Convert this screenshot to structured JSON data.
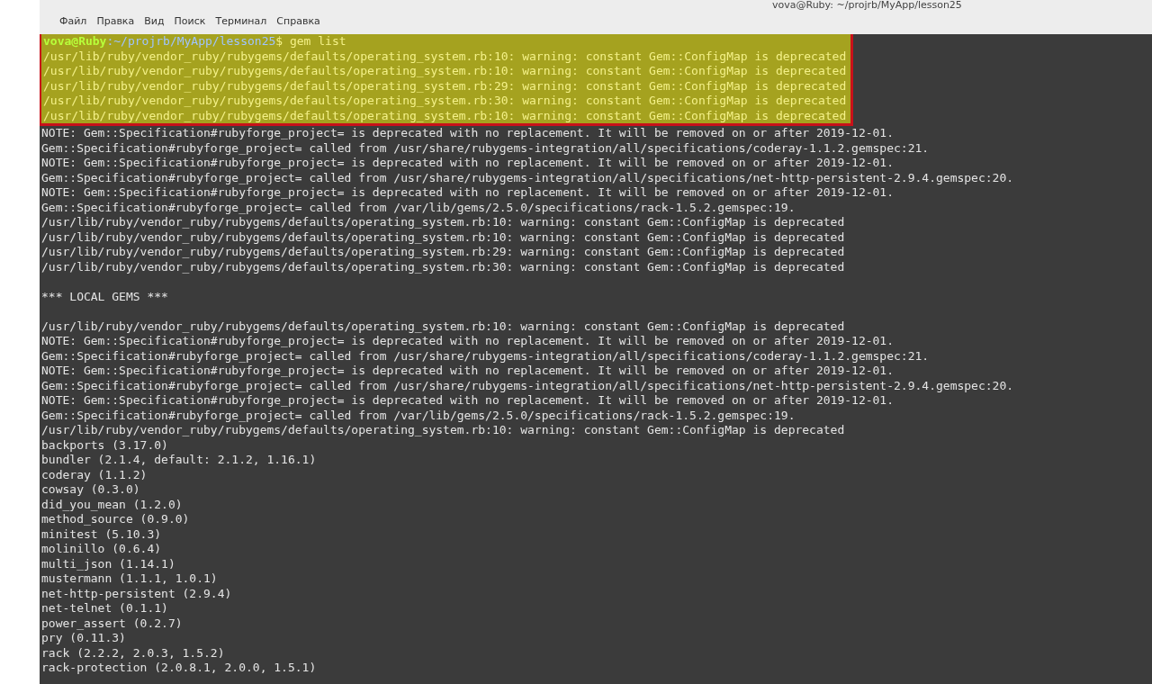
{
  "window": {
    "title": "vova@Ruby: ~/projrb/MyApp/lesson25"
  },
  "menu": [
    {
      "label": "Файл"
    },
    {
      "label": "Правка"
    },
    {
      "label": "Вид"
    },
    {
      "label": "Поиск"
    },
    {
      "label": "Терминал"
    },
    {
      "label": "Справка"
    }
  ],
  "terminal": {
    "lines": [
      {
        "kind": "prompt",
        "user": "vova@Ruby",
        "path": ":~/projrb/MyApp/lesson25",
        "command": "$ gem list",
        "highlighted": true
      },
      {
        "kind": "output",
        "text": "/usr/lib/ruby/vendor_ruby/rubygems/defaults/operating_system.rb:10: warning: constant Gem::ConfigMap is deprecated",
        "highlighted": true
      },
      {
        "kind": "output",
        "text": "/usr/lib/ruby/vendor_ruby/rubygems/defaults/operating_system.rb:10: warning: constant Gem::ConfigMap is deprecated",
        "highlighted": true
      },
      {
        "kind": "output",
        "text": "/usr/lib/ruby/vendor_ruby/rubygems/defaults/operating_system.rb:29: warning: constant Gem::ConfigMap is deprecated",
        "highlighted": true
      },
      {
        "kind": "output",
        "text": "/usr/lib/ruby/vendor_ruby/rubygems/defaults/operating_system.rb:30: warning: constant Gem::ConfigMap is deprecated",
        "highlighted": true
      },
      {
        "kind": "output",
        "text": "/usr/lib/ruby/vendor_ruby/rubygems/defaults/operating_system.rb:10: warning: constant Gem::ConfigMap is deprecated",
        "highlighted": true
      },
      {
        "kind": "output",
        "text": "NOTE: Gem::Specification#rubyforge_project= is deprecated with no replacement. It will be removed on or after 2019-12-01.",
        "highlighted": false
      },
      {
        "kind": "output",
        "text": "Gem::Specification#rubyforge_project= called from /usr/share/rubygems-integration/all/specifications/coderay-1.1.2.gemspec:21.",
        "highlighted": false
      },
      {
        "kind": "output",
        "text": "NOTE: Gem::Specification#rubyforge_project= is deprecated with no replacement. It will be removed on or after 2019-12-01.",
        "highlighted": false
      },
      {
        "kind": "output",
        "text": "Gem::Specification#rubyforge_project= called from /usr/share/rubygems-integration/all/specifications/net-http-persistent-2.9.4.gemspec:20.",
        "highlighted": false
      },
      {
        "kind": "output",
        "text": "NOTE: Gem::Specification#rubyforge_project= is deprecated with no replacement. It will be removed on or after 2019-12-01.",
        "highlighted": false
      },
      {
        "kind": "output",
        "text": "Gem::Specification#rubyforge_project= called from /var/lib/gems/2.5.0/specifications/rack-1.5.2.gemspec:19.",
        "highlighted": false
      },
      {
        "kind": "output",
        "text": "/usr/lib/ruby/vendor_ruby/rubygems/defaults/operating_system.rb:10: warning: constant Gem::ConfigMap is deprecated",
        "highlighted": false
      },
      {
        "kind": "output",
        "text": "/usr/lib/ruby/vendor_ruby/rubygems/defaults/operating_system.rb:10: warning: constant Gem::ConfigMap is deprecated",
        "highlighted": false
      },
      {
        "kind": "output",
        "text": "/usr/lib/ruby/vendor_ruby/rubygems/defaults/operating_system.rb:29: warning: constant Gem::ConfigMap is deprecated",
        "highlighted": false
      },
      {
        "kind": "output",
        "text": "/usr/lib/ruby/vendor_ruby/rubygems/defaults/operating_system.rb:30: warning: constant Gem::ConfigMap is deprecated",
        "highlighted": false
      },
      {
        "kind": "blank",
        "highlighted": false
      },
      {
        "kind": "output",
        "text": "*** LOCAL GEMS ***",
        "highlighted": false
      },
      {
        "kind": "blank",
        "highlighted": false
      },
      {
        "kind": "output",
        "text": "/usr/lib/ruby/vendor_ruby/rubygems/defaults/operating_system.rb:10: warning: constant Gem::ConfigMap is deprecated",
        "highlighted": false
      },
      {
        "kind": "output",
        "text": "NOTE: Gem::Specification#rubyforge_project= is deprecated with no replacement. It will be removed on or after 2019-12-01.",
        "highlighted": false
      },
      {
        "kind": "output",
        "text": "Gem::Specification#rubyforge_project= called from /usr/share/rubygems-integration/all/specifications/coderay-1.1.2.gemspec:21.",
        "highlighted": false
      },
      {
        "kind": "output",
        "text": "NOTE: Gem::Specification#rubyforge_project= is deprecated with no replacement. It will be removed on or after 2019-12-01.",
        "highlighted": false
      },
      {
        "kind": "output",
        "text": "Gem::Specification#rubyforge_project= called from /usr/share/rubygems-integration/all/specifications/net-http-persistent-2.9.4.gemspec:20.",
        "highlighted": false
      },
      {
        "kind": "output",
        "text": "NOTE: Gem::Specification#rubyforge_project= is deprecated with no replacement. It will be removed on or after 2019-12-01.",
        "highlighted": false
      },
      {
        "kind": "output",
        "text": "Gem::Specification#rubyforge_project= called from /var/lib/gems/2.5.0/specifications/rack-1.5.2.gemspec:19.",
        "highlighted": false
      },
      {
        "kind": "output",
        "text": "/usr/lib/ruby/vendor_ruby/rubygems/defaults/operating_system.rb:10: warning: constant Gem::ConfigMap is deprecated",
        "highlighted": false
      },
      {
        "kind": "output",
        "text": "backports (3.17.0)",
        "highlighted": false
      },
      {
        "kind": "output",
        "text": "bundler (2.1.4, default: 2.1.2, 1.16.1)",
        "highlighted": false
      },
      {
        "kind": "output",
        "text": "coderay (1.1.2)",
        "highlighted": false
      },
      {
        "kind": "output",
        "text": "cowsay (0.3.0)",
        "highlighted": false
      },
      {
        "kind": "output",
        "text": "did_you_mean (1.2.0)",
        "highlighted": false
      },
      {
        "kind": "output",
        "text": "method_source (0.9.0)",
        "highlighted": false
      },
      {
        "kind": "output",
        "text": "minitest (5.10.3)",
        "highlighted": false
      },
      {
        "kind": "output",
        "text": "molinillo (0.6.4)",
        "highlighted": false
      },
      {
        "kind": "output",
        "text": "multi_json (1.14.1)",
        "highlighted": false
      },
      {
        "kind": "output",
        "text": "mustermann (1.1.1, 1.0.1)",
        "highlighted": false
      },
      {
        "kind": "output",
        "text": "net-http-persistent (2.9.4)",
        "highlighted": false
      },
      {
        "kind": "output",
        "text": "net-telnet (0.1.1)",
        "highlighted": false
      },
      {
        "kind": "output",
        "text": "power_assert (0.2.7)",
        "highlighted": false
      },
      {
        "kind": "output",
        "text": "pry (0.11.3)",
        "highlighted": false
      },
      {
        "kind": "output",
        "text": "rack (2.2.2, 2.0.3, 1.5.2)",
        "highlighted": false
      },
      {
        "kind": "output",
        "text": "rack-protection (2.0.8.1, 2.0.0, 1.5.1)",
        "highlighted": false
      }
    ]
  }
}
